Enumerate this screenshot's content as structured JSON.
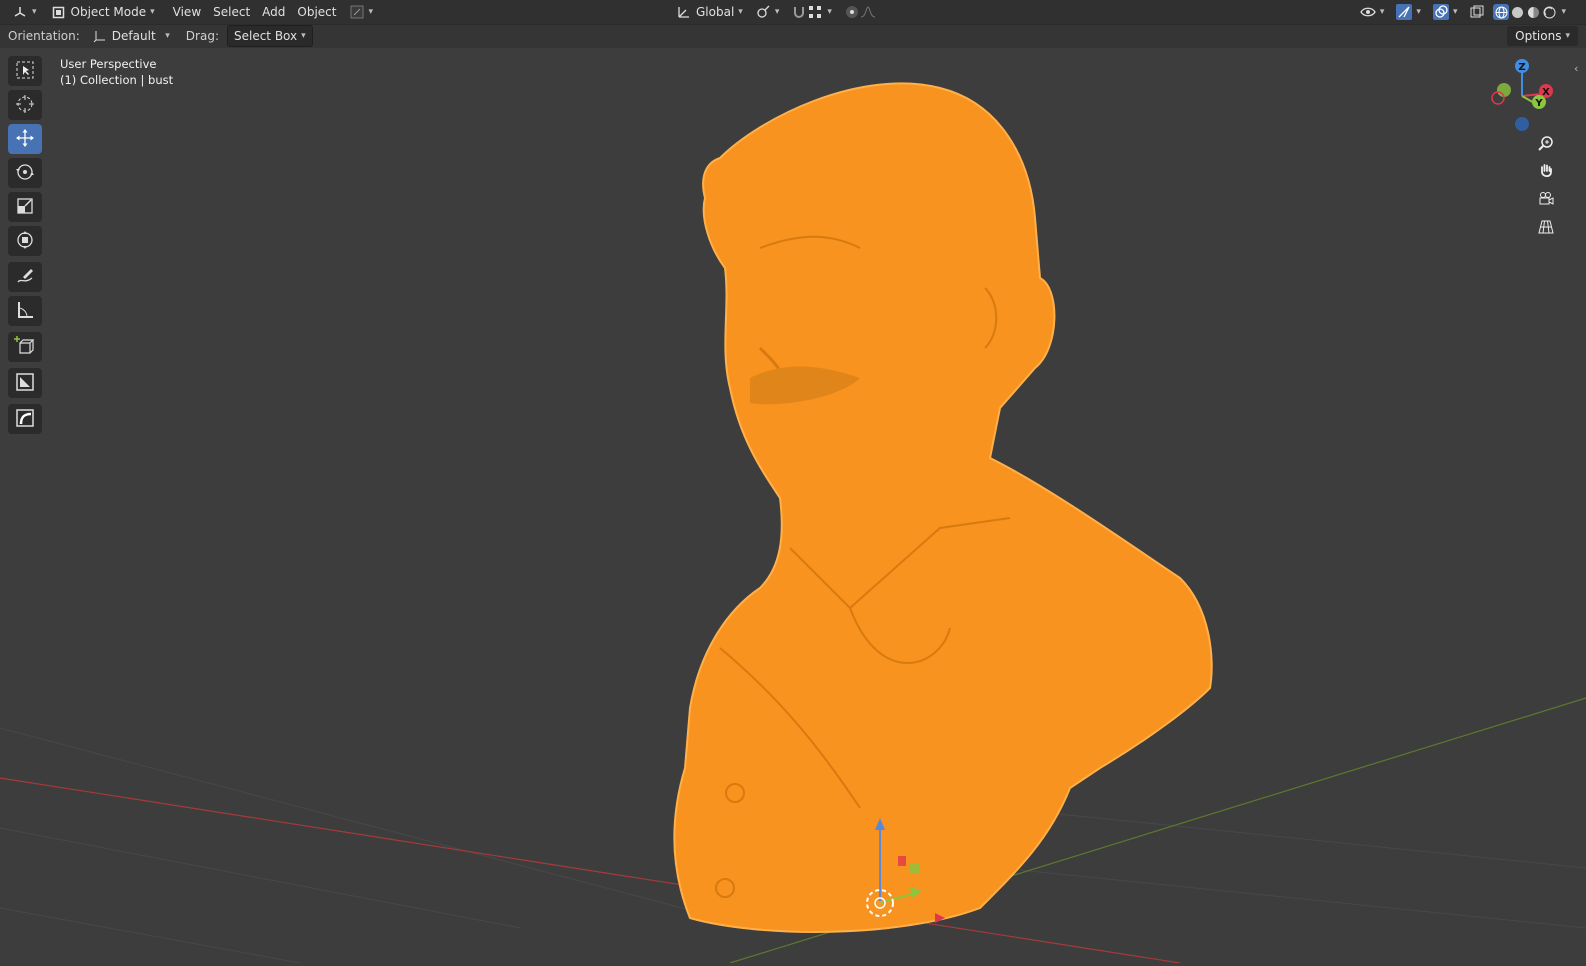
{
  "header": {
    "mode_label": "Object Mode",
    "menus": [
      "View",
      "Select",
      "Add",
      "Object"
    ],
    "transform_orientation": "Global"
  },
  "subbar": {
    "orientation_label": "Orientation:",
    "orientation_value": "Default",
    "drag_label": "Drag:",
    "drag_value": "Select Box",
    "options_label": "Options"
  },
  "viewport": {
    "view_name": "User Perspective",
    "collection_info": "(1) Collection | bust"
  },
  "toolbar": {
    "tools": [
      "select-box",
      "cursor",
      "move",
      "rotate",
      "scale",
      "transform",
      "annotate",
      "measure",
      "add-cube",
      "frame",
      "bevel"
    ],
    "active_tool": "move"
  },
  "gizmo": {
    "axes": [
      "Z",
      "X",
      "Y"
    ],
    "colors": {
      "x": "#e0374e",
      "y": "#8bc63e",
      "z": "#3f8de4"
    }
  },
  "colors": {
    "object_selected": "#f7931e",
    "background": "#3d3d3d",
    "active_tool": "#4772b3"
  }
}
